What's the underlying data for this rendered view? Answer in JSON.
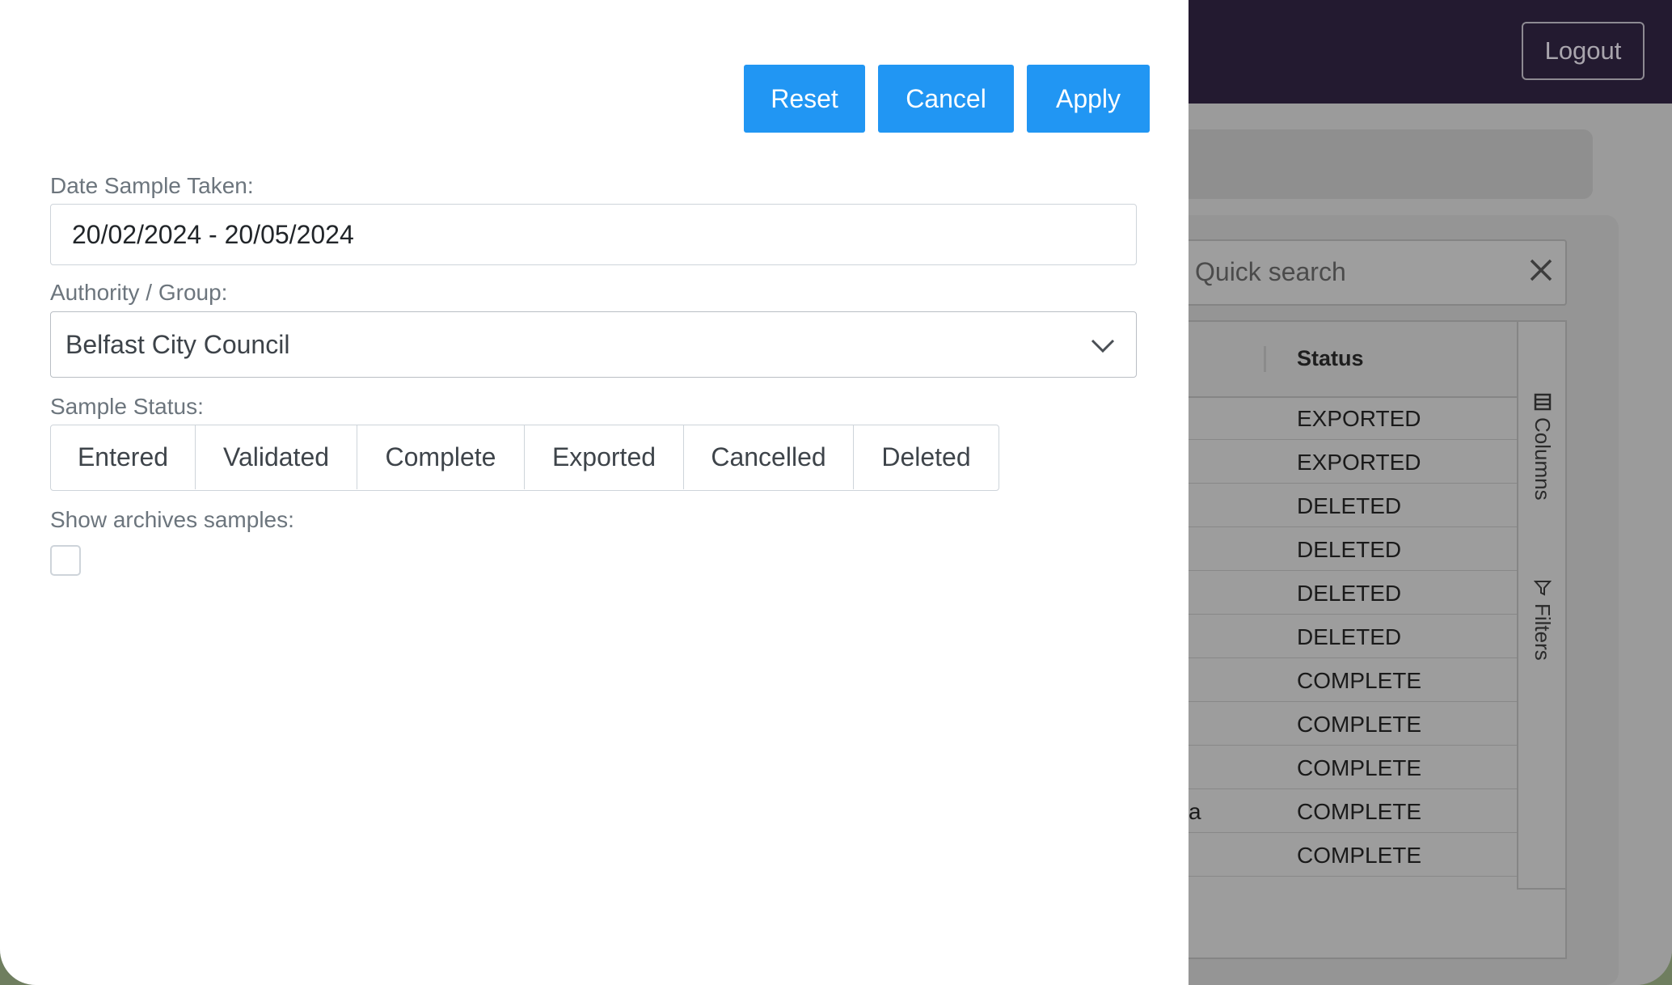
{
  "header": {
    "logout_label": "Logout"
  },
  "grid": {
    "quick_search_placeholder": "Quick search",
    "status_header": "Status",
    "rows": [
      {
        "frag": "",
        "status": "EXPORTED"
      },
      {
        "frag": "",
        "status": "EXPORTED"
      },
      {
        "frag": "",
        "status": "DELETED"
      },
      {
        "frag": "",
        "status": "DELETED"
      },
      {
        "frag": "",
        "status": "DELETED"
      },
      {
        "frag": "",
        "status": "DELETED"
      },
      {
        "frag": "",
        "status": "COMPLETE"
      },
      {
        "frag": "",
        "status": "COMPLETE"
      },
      {
        "frag": "",
        "status": "COMPLETE"
      },
      {
        "frag": "a",
        "status": "COMPLETE"
      },
      {
        "frag": "",
        "status": "COMPLETE"
      }
    ],
    "side_tabs": {
      "columns_label": "Columns",
      "filters_label": "Filters"
    }
  },
  "filter_panel": {
    "reset_label": "Reset",
    "cancel_label": "Cancel",
    "apply_label": "Apply",
    "date_label": "Date Sample Taken:",
    "date_value": "20/02/2024 - 20/05/2024",
    "authority_label": "Authority / Group:",
    "authority_value": "Belfast City Council",
    "status_label": "Sample Status:",
    "status_options": [
      "Entered",
      "Validated",
      "Complete",
      "Exported",
      "Cancelled",
      "Deleted"
    ],
    "archives_label": "Show archives samples:",
    "archives_checked": false
  },
  "colors": {
    "primary_button": "#2196f3",
    "header_bg": "#231a30",
    "overlay_bg": "#9b9b9b"
  }
}
